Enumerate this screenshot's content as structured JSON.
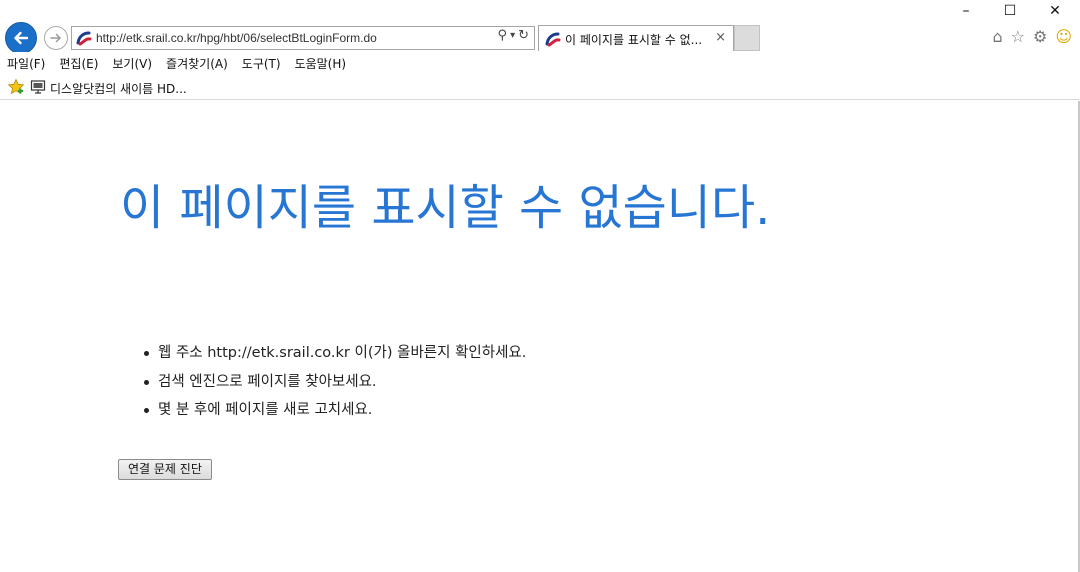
{
  "browser": {
    "url": "http://etk.srail.co.kr/hpg/hbt/06/selectBtLoginForm.do",
    "tab_title": "이 페이지를 표시할 수 없...",
    "tab_close": "×",
    "window_controls": {
      "minimize": "–",
      "maximize": "☐",
      "close": "✕"
    },
    "address_tools": {
      "search": "⚲",
      "dropdown": "▾",
      "refresh": "↻"
    },
    "right_icons": {
      "home": "⌂",
      "favorites": "☆",
      "settings": "⚙",
      "feedback": "☺"
    }
  },
  "menu": [
    "파일(F)",
    "편집(E)",
    "보기(V)",
    "즐겨찾기(A)",
    "도구(T)",
    "도움말(H)"
  ],
  "favorites_bar": {
    "item_label": "디스알닷컴의 새이름 HD..."
  },
  "error_page": {
    "heading": "이 페이지를 표시할 수 없습니다.",
    "suggestions": [
      "웹 주소 http://etk.srail.co.kr 이(가) 올바른지 확인하세요.",
      "검색 엔진으로 페이지를 찾아보세요.",
      "몇 분 후에 페이지를 새로 고치세요."
    ],
    "diagnose_button": "연결 문제 진단"
  },
  "colors": {
    "accent": "#2776d4",
    "back_button": "#1a6fc9"
  }
}
